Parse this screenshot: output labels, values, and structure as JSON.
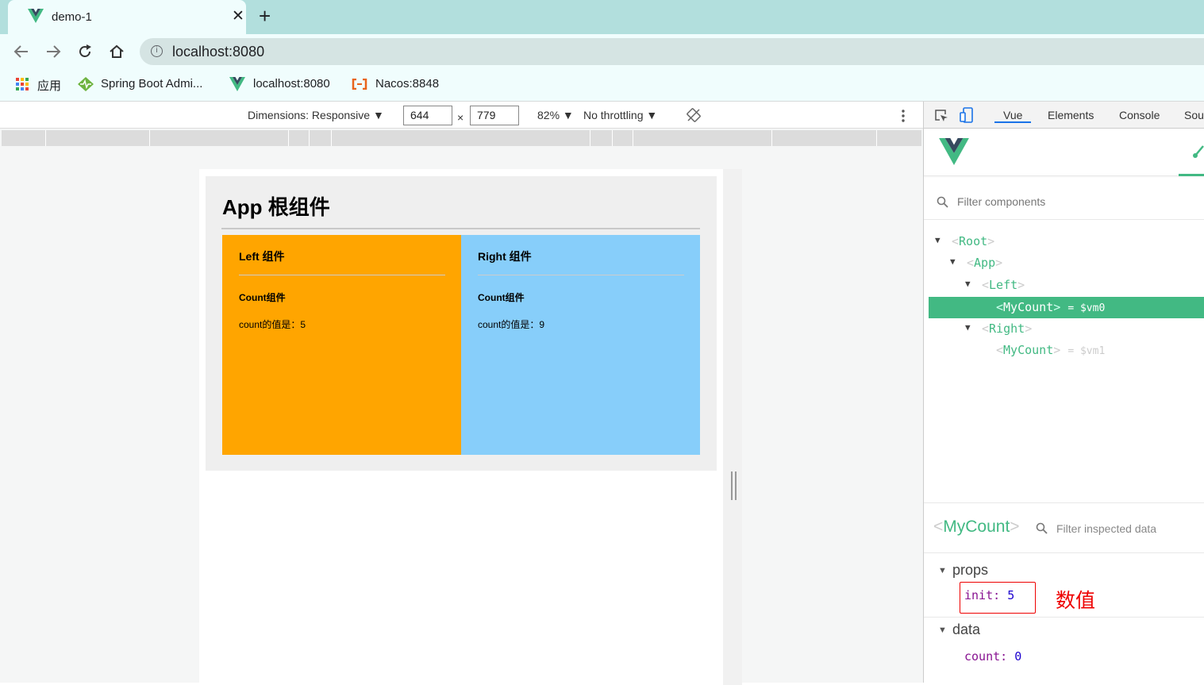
{
  "browser": {
    "tab_title": "demo-1",
    "new_tab_glyph": "+",
    "close_glyph": "✕",
    "url": "localhost:8080",
    "bookmarks": [
      {
        "label": "应用",
        "icon": "apps-grid-icon"
      },
      {
        "label": "Spring Boot Admi...",
        "icon": "spring-heart-icon"
      },
      {
        "label": "localhost:8080",
        "icon": "vue-logo-icon"
      },
      {
        "label": "Nacos:8848",
        "icon": "nacos-icon"
      }
    ]
  },
  "emulation": {
    "dimensions_label": "Dimensions: Responsive ▼",
    "width": "644",
    "times": "×",
    "height": "779",
    "zoom": "82% ▼",
    "throttling": "No throttling ▼"
  },
  "page": {
    "title": "App 根组件",
    "left": {
      "title": "Left 组件",
      "count_title": "Count组件",
      "count_text": "count的值是：5"
    },
    "right": {
      "title": "Right 组件",
      "count_title": "Count组件",
      "count_text": "count的值是：9"
    }
  },
  "devtools": {
    "tabs": [
      "Vue",
      "Elements",
      "Console",
      "Sou"
    ],
    "active_tab": "Vue",
    "filter_placeholder": "Filter components",
    "tree": {
      "root": "Root",
      "app": "App",
      "left": "Left",
      "left_child": "MyCount",
      "left_child_ref": "= $vm0",
      "right": "Right",
      "right_child": "MyCount",
      "right_child_ref": "= $vm1"
    },
    "inspector": {
      "component": "MyCount",
      "filter_placeholder": "Filter inspected data",
      "props_label": "props",
      "prop_key": "init:",
      "prop_value": "5",
      "annotation": "数值",
      "data_label": "data",
      "data_key": "count:",
      "data_value": "0"
    }
  },
  "colors": {
    "left_box": "#ffa500",
    "right_box": "#87cefa",
    "vue_green": "#42b983",
    "annotation_red": "#ee0000"
  }
}
